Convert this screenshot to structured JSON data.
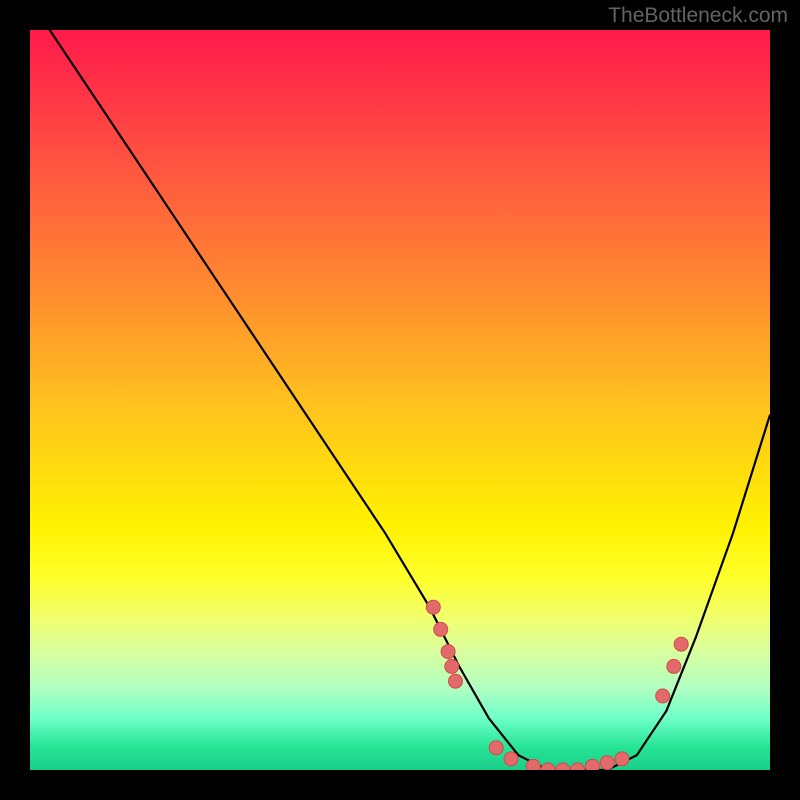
{
  "watermark": "TheBottleneck.com",
  "chart_data": {
    "type": "line",
    "title": "",
    "xlabel": "",
    "ylabel": "",
    "xlim": [
      0,
      100
    ],
    "ylim": [
      0,
      100
    ],
    "curve": {
      "x": [
        0,
        6,
        12,
        18,
        24,
        30,
        36,
        42,
        48,
        54,
        58,
        62,
        66,
        70,
        74,
        78,
        82,
        86,
        90,
        95,
        100
      ],
      "y": [
        104,
        95,
        86,
        77,
        68,
        59,
        50,
        41,
        32,
        22,
        14,
        7,
        2,
        0,
        0,
        0,
        2,
        8,
        18,
        32,
        48
      ]
    },
    "markers": [
      {
        "x": 54.5,
        "y": 22
      },
      {
        "x": 55.5,
        "y": 19
      },
      {
        "x": 56.5,
        "y": 16
      },
      {
        "x": 57.0,
        "y": 14
      },
      {
        "x": 57.5,
        "y": 12
      },
      {
        "x": 63.0,
        "y": 3
      },
      {
        "x": 65.0,
        "y": 1.5
      },
      {
        "x": 68.0,
        "y": 0.5
      },
      {
        "x": 70.0,
        "y": 0
      },
      {
        "x": 72.0,
        "y": 0
      },
      {
        "x": 74.0,
        "y": 0
      },
      {
        "x": 76.0,
        "y": 0.5
      },
      {
        "x": 78.0,
        "y": 1
      },
      {
        "x": 80.0,
        "y": 1.5
      },
      {
        "x": 85.5,
        "y": 10
      },
      {
        "x": 87.0,
        "y": 14
      },
      {
        "x": 88.0,
        "y": 17
      }
    ]
  }
}
